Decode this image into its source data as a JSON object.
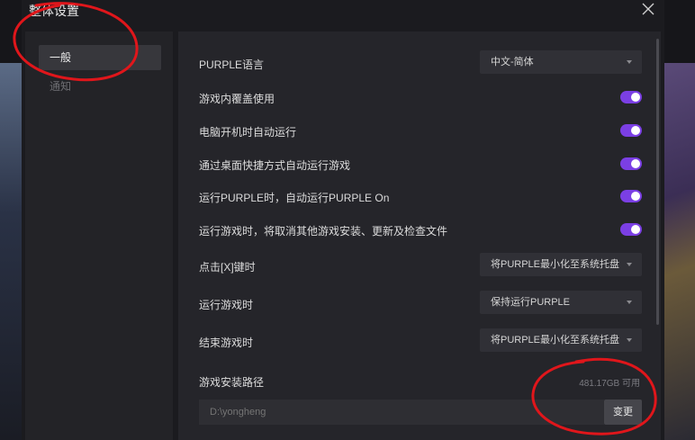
{
  "dialog": {
    "title": "整体设置",
    "close_icon": "close-icon"
  },
  "sidebar": {
    "items": [
      {
        "label": "一般",
        "active": true
      },
      {
        "label": "通知",
        "active": false
      }
    ]
  },
  "settings": {
    "language": {
      "label": "PURPLE语言",
      "value": "中文-简体"
    },
    "toggles": [
      {
        "label": "游戏内覆盖使用",
        "on": true
      },
      {
        "label": "电脑开机时自动运行",
        "on": true
      },
      {
        "label": "通过桌面快捷方式自动运行游戏",
        "on": true
      },
      {
        "label": "运行PURPLE时，自动运行PURPLE On",
        "on": true
      },
      {
        "label": "运行游戏时，将取消其他游戏安装、更新及检查文件",
        "on": true
      }
    ],
    "selects": [
      {
        "label": "点击[X]键时",
        "value": "将PURPLE最小化至系统托盘"
      },
      {
        "label": "运行游戏时",
        "value": "保持运行PURPLE"
      },
      {
        "label": "结束游戏时",
        "value": "将PURPLE最小化至系统托盘"
      }
    ],
    "install_path": {
      "label": "游戏安装路径",
      "free_space": "481.17GB 可用",
      "placeholder": "D:\\yongheng",
      "change_label": "变更"
    }
  },
  "colors": {
    "accent": "#7b3fe4",
    "annotation": "#e0161b"
  }
}
